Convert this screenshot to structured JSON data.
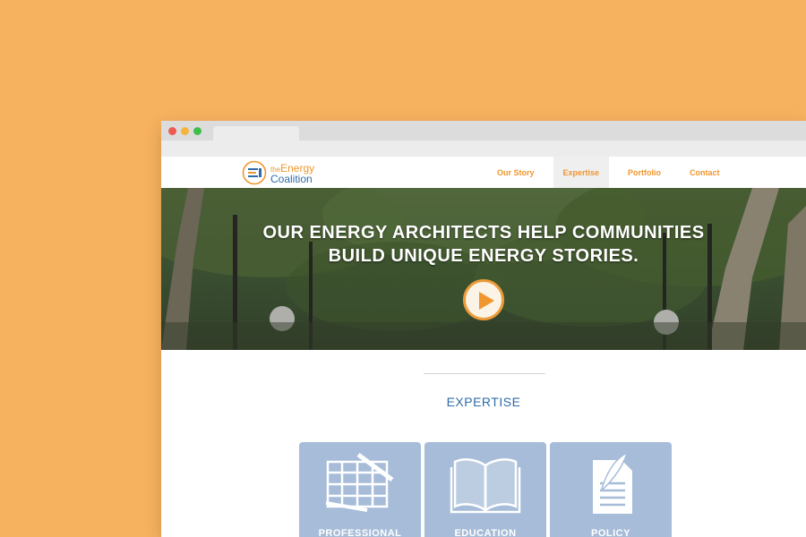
{
  "header": {
    "logo": {
      "small": "the",
      "energy": "Energy",
      "coalition": "Coalition"
    },
    "nav": [
      {
        "label": "Our Story"
      },
      {
        "label": "Expertise",
        "active": true
      },
      {
        "label": "Portfolio"
      },
      {
        "label": "Contact"
      }
    ]
  },
  "hero": {
    "line1": "OUR ENERGY ARCHITECTS HELP COMMUNITIES",
    "line2": "BUILD UNIQUE ENERGY STORIES.",
    "play_icon": "play-icon"
  },
  "section": {
    "title": "EXPERTISE"
  },
  "cards": [
    {
      "label": "PROFESSIONAL",
      "icon": "blueprint-icon"
    },
    {
      "label": "EDUCATION",
      "icon": "book-icon"
    },
    {
      "label": "POLICY",
      "icon": "document-quill-icon"
    }
  ],
  "colors": {
    "background": "#f7b25f",
    "accent_orange": "#f0962e",
    "brand_blue": "#2f6ca7",
    "card_blue": "#a6bcd8"
  }
}
